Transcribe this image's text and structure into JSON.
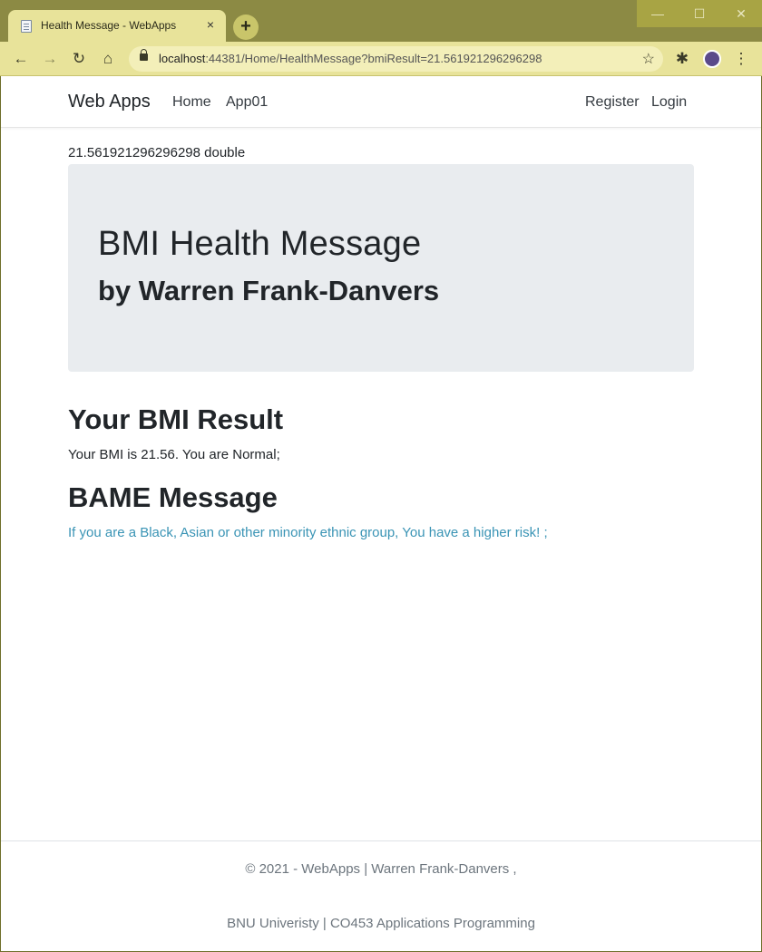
{
  "browser": {
    "tab_title": "Health Message - WebApps",
    "tab_close": "×",
    "new_tab": "+",
    "window_controls": [
      "—",
      "☐",
      "✕"
    ],
    "url_host": "localhost",
    "url_rest": ":44381/Home/HealthMessage?bmiResult=21.561921296296298",
    "icons": [
      "back-icon",
      "forward-icon",
      "reload-icon",
      "home-icon",
      "lock-icon",
      "star-icon",
      "extensions-icon",
      "profile-avatar",
      "menu-icon"
    ]
  },
  "navbar": {
    "brand": "Web Apps",
    "links": [
      "Home",
      "App01"
    ],
    "right_links": [
      "Register",
      "Login"
    ]
  },
  "main": {
    "debug_value": "21.561921296296298 double",
    "jumbotron_title": "BMI Health Message",
    "jumbotron_subtitle": "by Warren Frank-Danvers",
    "result_heading": "Your BMI Result",
    "result_text": "Your BMI is 21.56. You are Normal;",
    "bame_heading": "BAME Message",
    "bame_text": "If you are a Black, Asian or other minority ethnic group, You have a higher risk! ;"
  },
  "footer": {
    "line1": "© 2021 - WebApps | Warren Frank-Danvers ,",
    "line2": "BNU Univeristy | CO453 Applications Programming"
  },
  "colors": {
    "chrome_frame": "#8c8a44",
    "chrome_toolbar": "#e8e39a",
    "jumbotron_bg": "#e9ecef",
    "bame_text": "#3a94b5"
  }
}
